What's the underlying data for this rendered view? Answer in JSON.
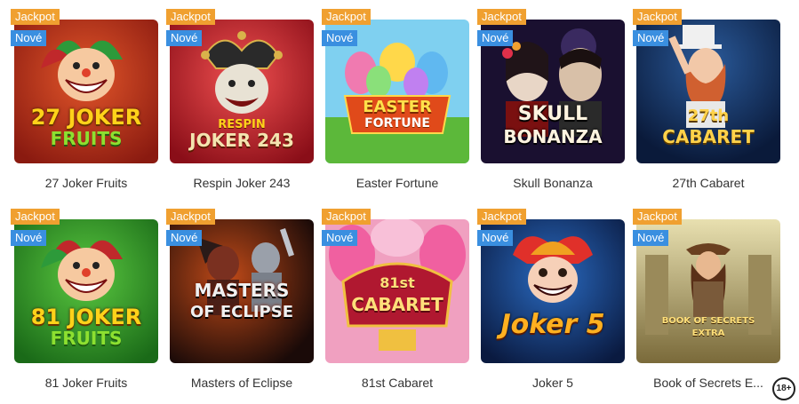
{
  "badges": {
    "jackpot": "Jackpot",
    "new": "Nové"
  },
  "games": [
    {
      "name": "27 Joker Fruits",
      "logo_lines": [
        "27 JOKER",
        "FRUITS"
      ]
    },
    {
      "name": "Respin Joker 243",
      "logo_lines": [
        "RESPIN",
        "JOKER 243"
      ]
    },
    {
      "name": "Easter Fortune",
      "logo_lines": [
        "EASTER",
        "FORTUNE"
      ]
    },
    {
      "name": "Skull Bonanza",
      "logo_lines": [
        "SKULL",
        "BONANZA"
      ]
    },
    {
      "name": "27th Cabaret",
      "logo_lines": [
        "27th",
        "CABARET"
      ]
    },
    {
      "name": "81 Joker Fruits",
      "logo_lines": [
        "81 JOKER",
        "FRUITS"
      ]
    },
    {
      "name": "Masters of Eclipse",
      "logo_lines": [
        "MASTERS",
        "OF ECLIPSE"
      ]
    },
    {
      "name": "81st Cabaret",
      "logo_lines": [
        "81st",
        "CABARET"
      ]
    },
    {
      "name": "Joker 5",
      "logo_lines": [
        "Joker",
        "5"
      ]
    },
    {
      "name": "Book of Secrets E...",
      "logo_lines": [
        "BOOK OF SECRETS",
        "EXTRA"
      ]
    }
  ],
  "age_badge": "18+",
  "colors": {
    "jackpot_badge": "#f0a030",
    "new_badge": "#3a8fe0"
  }
}
